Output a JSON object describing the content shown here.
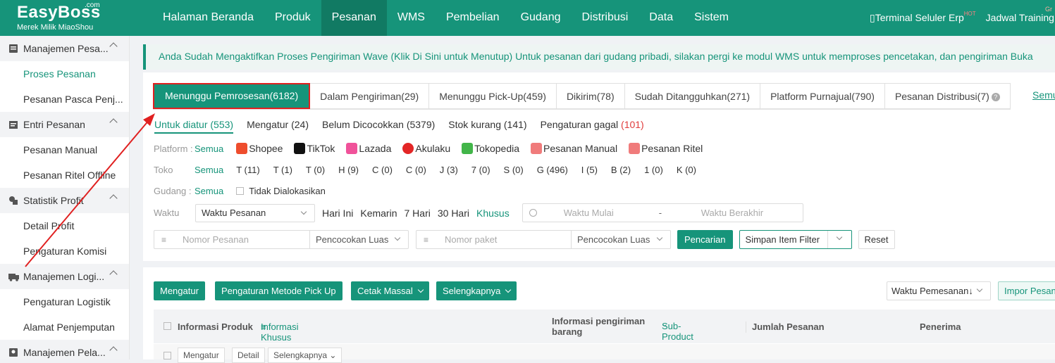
{
  "brand": {
    "name": "EasyBoss",
    "suffix": ".com",
    "subtitle": "Merek Milik MiaoShou",
    "accent": "#16947a"
  },
  "nav": {
    "items": [
      "Halaman Beranda",
      "Produk",
      "Pesanan",
      "WMS",
      "Pembelian",
      "Gudang",
      "Distribusi",
      "Data",
      "Sistem"
    ],
    "active": "Pesanan"
  },
  "topright": {
    "terminal": "Terminal Seluler Erp",
    "terminal_badge": "HOT",
    "training": "Jadwal Training",
    "corner_badge": "Gr"
  },
  "sidebar": {
    "groups": [
      {
        "label": "Manajemen Pesa...",
        "icon": "order-icon",
        "items": [
          "Proses Pesanan",
          "Pesanan Pasca Penj..."
        ]
      },
      {
        "label": "Entri Pesanan",
        "icon": "entry-icon",
        "items": [
          "Pesanan Manual",
          "Pesanan Ritel Offline"
        ]
      },
      {
        "label": "Statistik Profit",
        "icon": "stats-icon",
        "items": [
          "Detail Profit",
          "Pengaturan Komisi"
        ]
      },
      {
        "label": "Manajemen Logi...",
        "icon": "truck-icon",
        "items": [
          "Pengaturan Logistik",
          "Alamat Penjemputan"
        ]
      },
      {
        "label": "Manajemen Pela...",
        "icon": "customer-icon",
        "items": []
      }
    ],
    "active_item": "Proses Pesanan"
  },
  "banner": {
    "text": "Anda Sudah Mengaktifkan Proses Pengiriman Wave (Klik Di Sini untuk Menutup) Untuk pesanan dari gudang pribadi, silakan pergi ke modul WMS untuk memproses pencetakan, dan pengiriman  Buka"
  },
  "tabs": [
    {
      "label": "Menunggu Pemrosesan(6182)"
    },
    {
      "label": "Dalam Pengiriman(29)"
    },
    {
      "label": "Menunggu Pick-Up(459)"
    },
    {
      "label": "Dikirim(78)"
    },
    {
      "label": "Sudah Ditangguhkan(271)"
    },
    {
      "label": "Platform Purnajual(790)"
    },
    {
      "label": "Pesanan Distribusi(7)"
    }
  ],
  "tabs_link": "Semu",
  "subtabs": [
    {
      "label": "Untuk diatur (553)"
    },
    {
      "label": "Mengatur (24)"
    },
    {
      "label": "Belum Dicocokkan (5379)"
    },
    {
      "label": "Stok kurang (141)"
    },
    {
      "label": "Pengaturan gagal",
      "count": "(101)"
    }
  ],
  "filters": {
    "all": "Semua",
    "platform_label": "Platform :",
    "platforms": [
      {
        "name": "Shopee",
        "color": "#ee4d2d"
      },
      {
        "name": "TikTok",
        "color": "#111111"
      },
      {
        "name": "Lazada",
        "color": "#f0529a"
      },
      {
        "name": "Akulaku",
        "color": "#e32626"
      },
      {
        "name": "Tokopedia",
        "color": "#42b549"
      },
      {
        "name": "Pesanan Manual",
        "color": "#f07b7b"
      },
      {
        "name": "Pesanan Ritel",
        "color": "#f07b7b"
      }
    ],
    "store_label": "Toko",
    "stores": [
      "T (11)",
      "T (1)",
      "T (0)",
      "H (9)",
      "C (0)",
      "C (0)",
      "J (3)",
      "7 (0)",
      "S (0)",
      "G (496)",
      "I (5)",
      "B (2)",
      "1 (0)",
      "K (0)"
    ],
    "warehouse_label": "Gudang :",
    "unallocated": "Tidak Dialokasikan",
    "time_label": "Waktu",
    "time_type": "Waktu Pesanan",
    "time_quick": [
      "Hari Ini",
      "Kemarin",
      "7 Hari",
      "30 Hari"
    ],
    "time_custom": "Khusus",
    "start_placeholder": "Waktu Mulai",
    "date_sep": "-",
    "end_placeholder": "Waktu Berakhir",
    "order_no_placeholder": "Nomor Pesanan",
    "match1": "Pencocokan Luas",
    "package_placeholder": "Nomor paket",
    "match2": "Pencocokan Luas",
    "search": "Pencarian",
    "save_filter": "Simpan Item Filter",
    "reset": "Reset"
  },
  "actions": {
    "arrange": "Mengatur",
    "pickup": "Pengaturan Metode Pick Up",
    "print": "Cetak Massal",
    "more": "Selengkapnya",
    "sort": "Waktu Pemesanan↓",
    "import": "Impor Pesan"
  },
  "table": {
    "headers": {
      "product": "Informasi Produk",
      "special": "Informasi Khusus",
      "shipping": "Informasi pengiriman barang",
      "sub_product": "Sub-Product",
      "qty": "Jumlah Pesanan",
      "receiver": "Penerima"
    },
    "row_actions": [
      "Mengatur",
      "Detail",
      "Selengkapnya"
    ]
  }
}
